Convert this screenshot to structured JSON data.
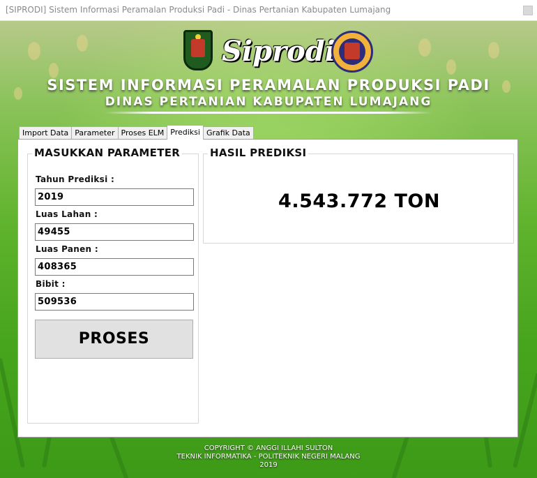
{
  "window": {
    "title": "[SIPRODI] Sistem Informasi Peramalan Produksi Padi - Dinas Pertanian Kabupaten Lumajang"
  },
  "header": {
    "brand": "Siprodi",
    "title_line1": "SISTEM INFORMASI PERAMALAN PRODUKSI PADI",
    "title_line2": "DINAS PERTANIAN KABUPATEN LUMAJANG"
  },
  "tabs": [
    {
      "label": "Import Data",
      "active": false
    },
    {
      "label": "Parameter",
      "active": false
    },
    {
      "label": "Proses ELM",
      "active": false
    },
    {
      "label": "Prediksi",
      "active": true
    },
    {
      "label": "Grafik Data",
      "active": false
    }
  ],
  "parameters": {
    "group_title": "MASUKKAN PARAMETER",
    "fields": [
      {
        "label": "Tahun Prediksi :",
        "value": "2019"
      },
      {
        "label": "Luas Lahan :",
        "value": "49455"
      },
      {
        "label": "Luas Panen :",
        "value": "408365"
      },
      {
        "label": "Bibit :",
        "value": "509536"
      }
    ],
    "button_label": "PROSES"
  },
  "result": {
    "group_title": "HASIL PREDIKSI",
    "value": "4.543.772 TON"
  },
  "footer": {
    "line1": "COPYRIGHT © ANGGI ILLAHI SULTON",
    "line2": "TEKNIK INFORMATIKA - POLITEKNIK NEGERI MALANG",
    "line3": "2019"
  }
}
